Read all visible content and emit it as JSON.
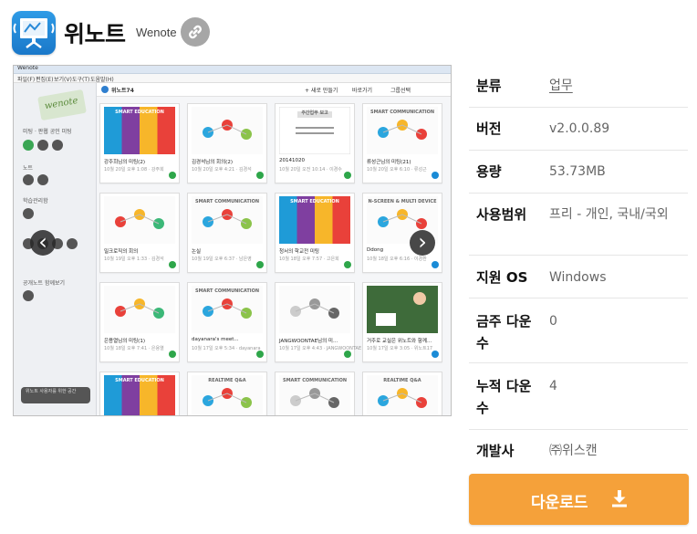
{
  "app": {
    "name": "위노트",
    "subtitle": "Wenote",
    "link_icon": "link-icon",
    "app_icon": "presentation-board-icon",
    "accent": "#1a78c9"
  },
  "screenshot": {
    "window_title": "Wenote",
    "menu": [
      "파일(F)",
      "편집(E)",
      "보기(V)",
      "도구(T)",
      "도움말(H)"
    ],
    "toolbar": {
      "crumb": "위노트74",
      "new_label": "+ 새로 만들기",
      "shortcut_label": "바로가기",
      "group_label": "그룹선택"
    },
    "left_panel": {
      "logo": "wenote",
      "sections": [
        "미팅 · 판웹 공인 미팅",
        "노트",
        "학습관리함",
        "공개노트 함께보기"
      ],
      "badge_text": "위노트 사용자를 위한 공간"
    },
    "cards": [
      {
        "title": "SMART EDUCATION",
        "t1": "강주희님의 미팅(2)",
        "t2": "10월 20일 오후 1:08 · 강주희"
      },
      {
        "title": "",
        "t1": "김경석님의 회의(2)",
        "t2": "10월 20일 오후 4:21 · 김경석"
      },
      {
        "title": "주간업무 보고",
        "t1": "20141020",
        "t2": "10월 20일 오전 10:14 · 이경수"
      },
      {
        "title": "SMART COMMUNICATION",
        "t1": "류성근님의 미팅(21)",
        "t2": "10월 20일 오후 6:10 · 류성근"
      },
      {
        "title": "",
        "t1": "밀크로직의 회의",
        "t2": "10월 19일 오후 1:33 · 김경석"
      },
      {
        "title": "SMART COMMUNICATION",
        "t1": "논실",
        "t2": "10월 19일 오후 6:37 · 남은영"
      },
      {
        "title": "SMART EDUCATION",
        "t1": "청서의 학교전 미팅",
        "t2": "10월 18일 오후 7:57 · 고은희"
      },
      {
        "title": "N-SCREEN & MULTI DEVICE",
        "t1": "Ddong",
        "t2": "10월 18일 오후 6:16 · 이경환"
      },
      {
        "title": "",
        "t1": "은용열님의 미팅(1)",
        "t2": "10월 18일 오후 7:41 · 은용열"
      },
      {
        "title": "SMART COMMUNICATION",
        "t1": "dayanara's meet...",
        "t2": "10월 17일 오후 5:34 · dayanara"
      },
      {
        "title": "",
        "t1": "JANGWOONTAE님의 미...",
        "t2": "10월 17일 오후 4:43 · JANGWOONTAE"
      },
      {
        "title": "",
        "t1": "거주로 교실은 위노트와 함께...",
        "t2": "10월 17일 오후 3:05 · 위노트17"
      },
      {
        "title": "SMART EDUCATION",
        "t1": "",
        "t2": ""
      },
      {
        "title": "REALTIME Q&A",
        "t1": "",
        "t2": ""
      },
      {
        "title": "SMART COMMUNICATION",
        "t1": "",
        "t2": ""
      },
      {
        "title": "REALTIME Q&A",
        "t1": "",
        "t2": ""
      }
    ],
    "prev_icon": "chevron-left-icon",
    "next_icon": "chevron-right-icon"
  },
  "info": {
    "category_label": "분류",
    "category_value": "업무",
    "version_label": "버전",
    "version_value": "v2.0.0.89",
    "size_label": "용량",
    "size_value": "53.73MB",
    "license_label": "사용범위",
    "license_value": "프리 - 개인, 국내/국외",
    "os_label": "지원 OS",
    "os_value": "Windows",
    "weekly_label": "금주 다운수",
    "weekly_value": "0",
    "total_label": "누적 다운수",
    "total_value": "4",
    "developer_label": "개발사",
    "developer_value": "㈜위스캔"
  },
  "download": {
    "label": "다운로드",
    "icon": "download-icon",
    "color": "#f5a13a"
  }
}
